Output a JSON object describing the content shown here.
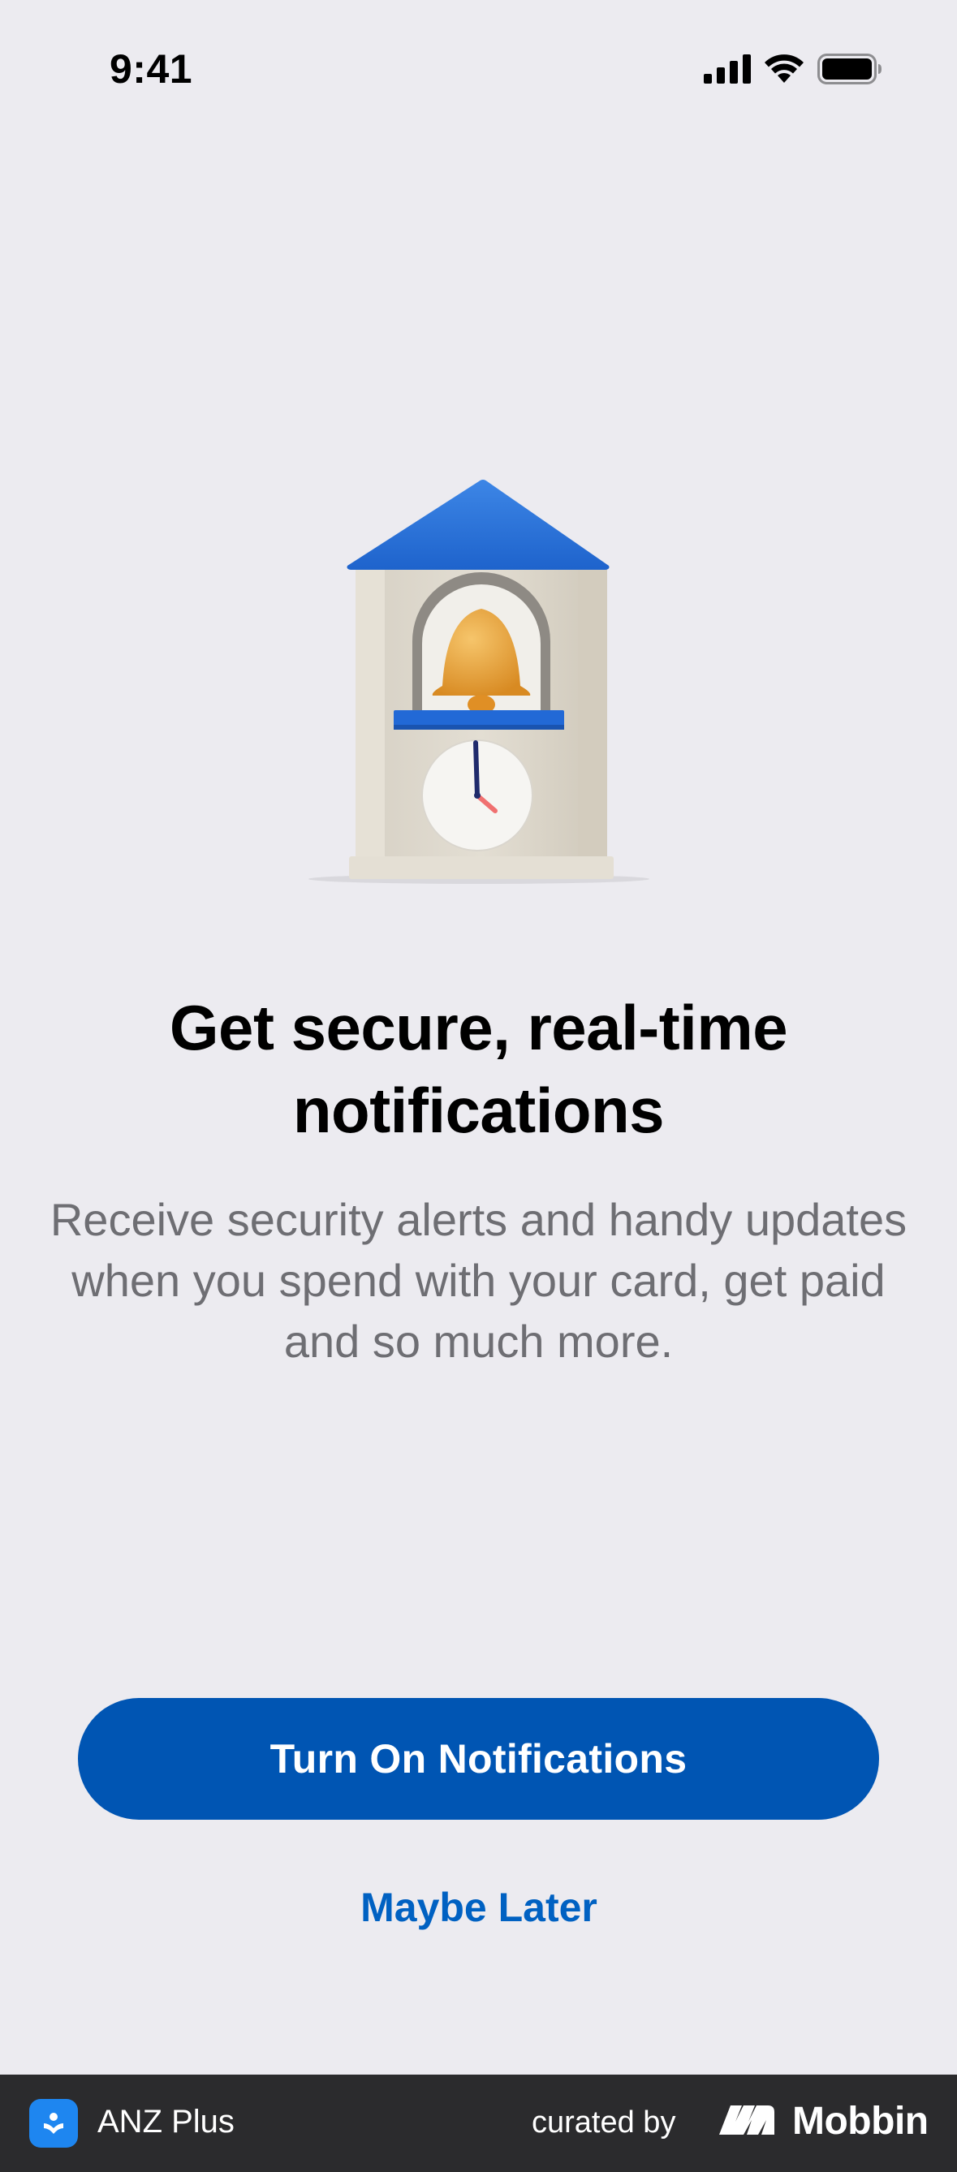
{
  "status_bar": {
    "time": "9:41"
  },
  "main": {
    "title": "Get secure, real-time notifications",
    "description": "Receive security alerts and handy updates when you spend with your card, get paid and so much more.",
    "primary_button_label": "Turn On Notifications",
    "secondary_button_label": "Maybe Later"
  },
  "footer": {
    "app_name": "ANZ Plus",
    "curated_label": "curated by",
    "brand": "Mobbin"
  },
  "colors": {
    "background": "#ECEBF0",
    "primary": "#0055B3",
    "link": "#0061C2",
    "footer_bg": "#2B2B2D"
  },
  "icons": {
    "signal": "cellular-signal-icon",
    "wifi": "wifi-icon",
    "battery": "battery-icon",
    "illustration": "bell-tower-clock-illustration",
    "app": "anz-plus-app-icon",
    "brand_logo": "mobbin-logo-icon"
  }
}
